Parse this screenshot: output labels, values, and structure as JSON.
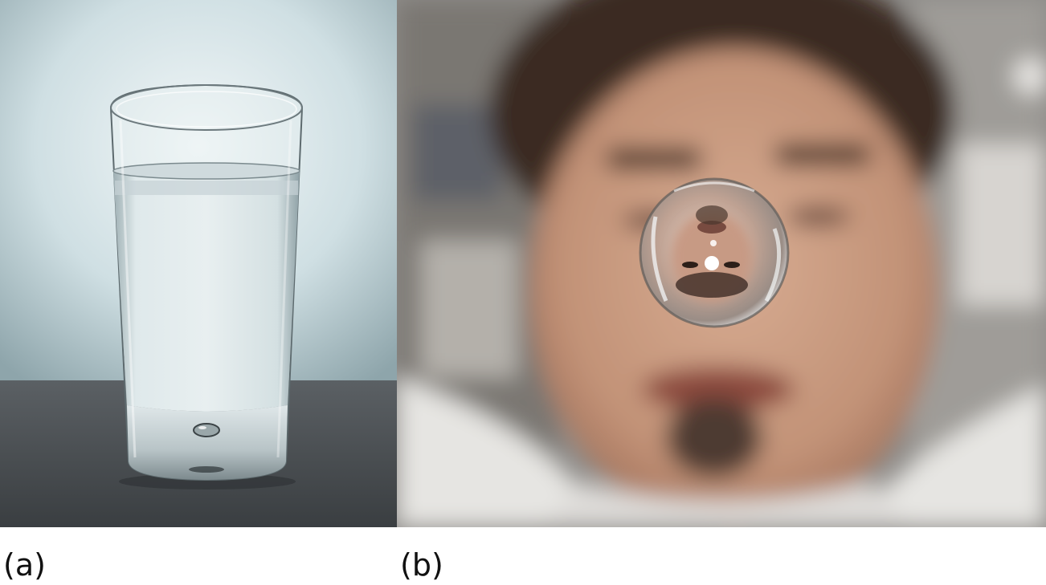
{
  "figure": {
    "panels": [
      {
        "label": "(a)",
        "subject": "glass-of-water"
      },
      {
        "label": "(b)",
        "subject": "floating-water-droplet-in-front-of-face"
      }
    ]
  },
  "colors": {
    "background": "#ffffff",
    "caption_text": "#111111",
    "panel_a_backdrop": "#cfe0e4",
    "panel_a_table": "#4b4f52",
    "panel_b_skin": "#c89f86",
    "panel_b_hair": "#3a2a22"
  }
}
